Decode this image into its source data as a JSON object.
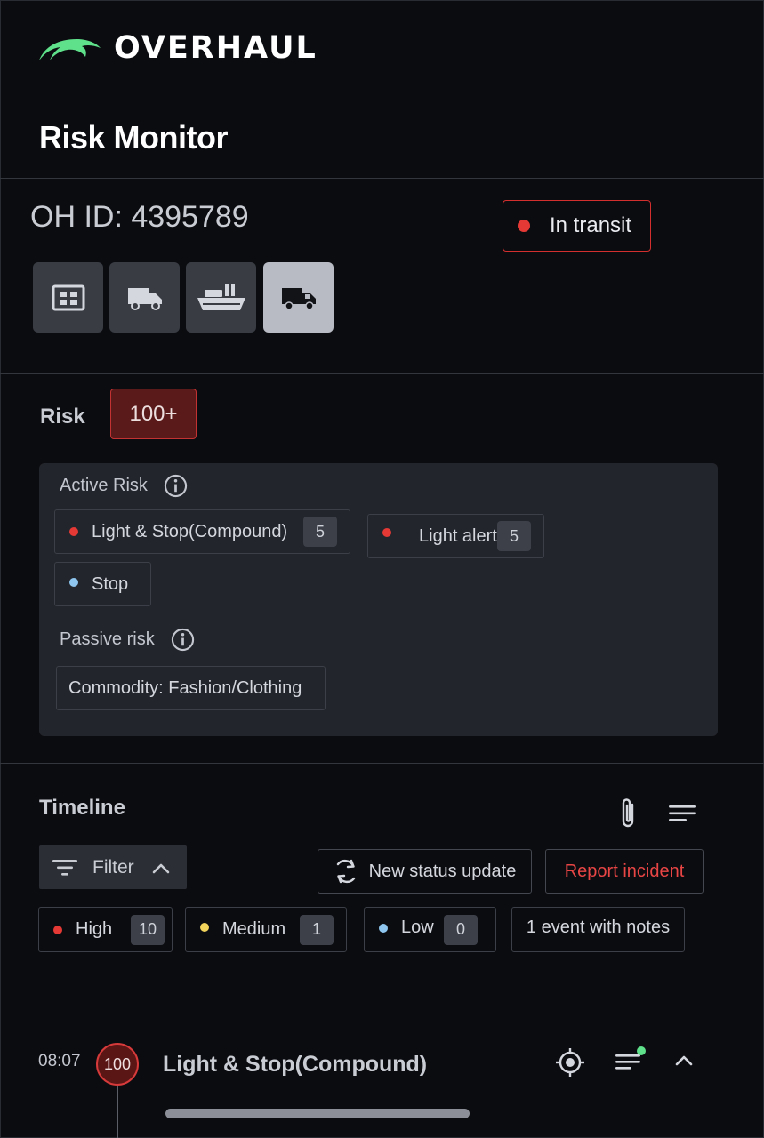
{
  "app": {
    "brand": "OVERHAUL",
    "accent": "#5fe08a"
  },
  "page_title": "Risk Monitor",
  "shipment": {
    "id_label": "OH ID: 4395789",
    "status": "In transit",
    "status_color": "#e53935",
    "modes": [
      {
        "icon": "grid-icon",
        "active": false
      },
      {
        "icon": "van-icon",
        "active": false
      },
      {
        "icon": "ship-icon",
        "active": false
      },
      {
        "icon": "truck-icon",
        "active": true
      }
    ]
  },
  "risk": {
    "label": "Risk",
    "score": "100+",
    "active_label": "Active Risk",
    "active_items": [
      {
        "label": "Light & Stop(Compound)",
        "count": "5",
        "color": "#e53935"
      },
      {
        "label": "Light alert",
        "count": "5",
        "color": "#e53935"
      },
      {
        "label": "Stop",
        "color": "#8ec6ef"
      }
    ],
    "passive_label": "Passive risk",
    "passive_items": [
      {
        "label": "Commodity: Fashion/Clothing"
      }
    ]
  },
  "timeline": {
    "title": "Timeline",
    "filter_label": "Filter",
    "new_status_label": "New status update",
    "report_label": "Report incident",
    "severities": [
      {
        "label": "High",
        "count": "10",
        "color": "#e53935"
      },
      {
        "label": "Medium",
        "count": "1",
        "color": "#f2d35c"
      },
      {
        "label": "Low",
        "count": "0",
        "color": "#8ec6ef"
      }
    ],
    "notes_label": "1 event with notes",
    "events": [
      {
        "time": "08:07",
        "score": "100",
        "title": "Light & Stop(Compound)"
      }
    ]
  }
}
